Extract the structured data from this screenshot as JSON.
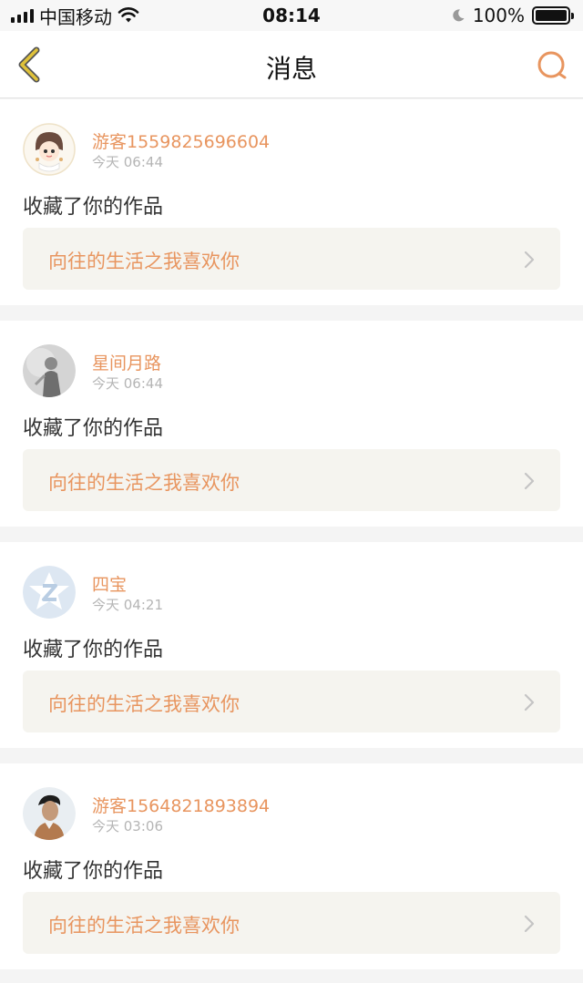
{
  "status_bar": {
    "carrier": "中国移动",
    "time": "08:14",
    "battery": "100%"
  },
  "header": {
    "title": "消息"
  },
  "messages": [
    {
      "user": "游客1559825696604",
      "time": "今天 06:44",
      "action": "收藏了你的作品",
      "work_title": "向往的生活之我喜欢你"
    },
    {
      "user": "星间月路",
      "time": "今天 06:44",
      "action": "收藏了你的作品",
      "work_title": "向往的生活之我喜欢你"
    },
    {
      "user": "四宝",
      "time": "今天 04:21",
      "action": "收藏了你的作品",
      "work_title": "向往的生活之我喜欢你"
    },
    {
      "user": "游客1564821893894",
      "time": "今天 03:06",
      "action": "收藏了你的作品",
      "work_title": "向往的生活之我喜欢你"
    }
  ],
  "colors": {
    "accent": "#e8955f",
    "back_icon": "#e0c23a",
    "muted": "#b5b5b5",
    "card_link_bg": "#f5f4ef"
  }
}
